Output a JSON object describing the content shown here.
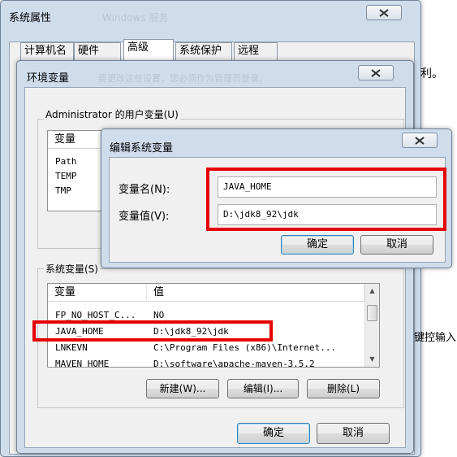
{
  "system_properties": {
    "title": "系统属性",
    "faded_title": "Windows 服务",
    "tabs": [
      {
        "label": "计算机名",
        "active": false
      },
      {
        "label": "硬件",
        "active": false
      },
      {
        "label": "高级",
        "active": true
      },
      {
        "label": "系统保护",
        "active": false
      },
      {
        "label": "远程",
        "active": false
      }
    ],
    "edge_text_1": "利。",
    "edge_text_2": "键控输入"
  },
  "env_vars": {
    "title": "环境变量",
    "faded_subtitle": "要更改这些设置，您必须作为管理员登录。",
    "user_group_label": "Administrator 的用户变量(U)",
    "user_list": {
      "col_variable": "变量",
      "col_value": "值",
      "rows": [
        {
          "name": "Path"
        },
        {
          "name": "TEMP"
        },
        {
          "name": "TMP"
        }
      ]
    },
    "system_group_label": "系统变量(S)",
    "system_list": {
      "col_variable": "变量",
      "col_value": "值",
      "rows": [
        {
          "name": "FP_NO_HOST_C...",
          "value": "NO"
        },
        {
          "name": "JAVA_HOME",
          "value": "D:\\jdk8_92\\jdk"
        },
        {
          "name": "LNKEVN",
          "value": "C:\\Program Files (x86)\\Internet..."
        },
        {
          "name": "MAVEN_HOME",
          "value": "D:\\software\\apache-maven-3.5.2"
        }
      ]
    },
    "buttons": {
      "new": "新建(W)...",
      "edit": "编辑(I)...",
      "delete": "删除(L)",
      "ok": "确定",
      "cancel": "取消"
    }
  },
  "edit_dialog": {
    "title": "编辑系统变量",
    "name_label": "变量名(N):",
    "name_value": "JAVA_HOME",
    "value_label": "变量值(V):",
    "value_value": "D:\\jdk8_92\\jdk",
    "ok": "确定",
    "cancel": "取消"
  },
  "colors": {
    "highlight": "#e60000",
    "window_frame": "#cfdcec"
  }
}
